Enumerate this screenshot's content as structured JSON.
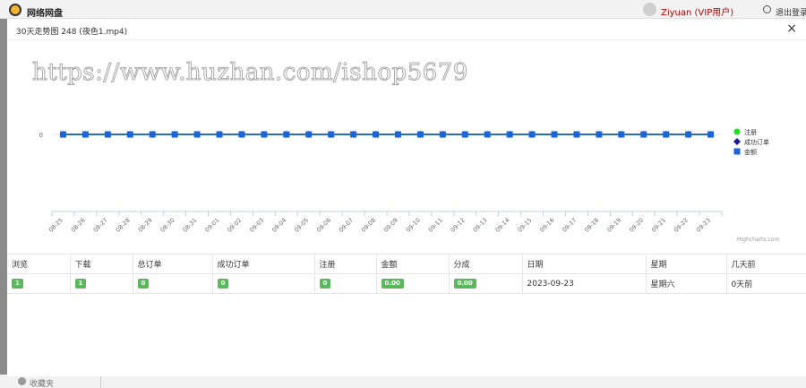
{
  "header": {
    "brand": "网络网盘",
    "user": "Ziyuan (VIP用户)",
    "logout": "退出登录"
  },
  "footer": {
    "favorites": "收藏夹"
  },
  "modal": {
    "title": "30天走势图 248 (夜色1.mp4)",
    "close": "×",
    "watermark": "https://www.huzhan.com/ishop5679"
  },
  "chart_data": {
    "type": "line",
    "x": [
      "08-25",
      "08-26",
      "08-27",
      "08-28",
      "08-29",
      "08-30",
      "08-31",
      "09-01",
      "09-02",
      "09-03",
      "09-04",
      "09-05",
      "09-06",
      "09-07",
      "09-08",
      "09-09",
      "09-10",
      "09-11",
      "09-12",
      "09-13",
      "09-14",
      "09-15",
      "09-16",
      "09-17",
      "09-18",
      "09-19",
      "09-20",
      "09-21",
      "09-22",
      "09-23"
    ],
    "y_ticks": [
      "0"
    ],
    "series": [
      {
        "name": "注册",
        "color": "#22dd22",
        "marker": "circle",
        "values": [
          0,
          0,
          0,
          0,
          0,
          0,
          0,
          0,
          0,
          0,
          0,
          0,
          0,
          0,
          0,
          0,
          0,
          0,
          0,
          0,
          0,
          0,
          0,
          0,
          0,
          0,
          0,
          0,
          0,
          0
        ]
      },
      {
        "name": "成功订单",
        "color": "#1a1a9a",
        "marker": "diamond",
        "values": [
          0,
          0,
          0,
          0,
          0,
          0,
          0,
          0,
          0,
          0,
          0,
          0,
          0,
          0,
          0,
          0,
          0,
          0,
          0,
          0,
          0,
          0,
          0,
          0,
          0,
          0,
          0,
          0,
          0,
          0
        ]
      },
      {
        "name": "金额",
        "color": "#1a66d8",
        "marker": "square",
        "values": [
          0,
          0,
          0,
          0,
          0,
          0,
          0,
          0,
          0,
          0,
          0,
          0,
          0,
          0,
          0,
          0,
          0,
          0,
          0,
          0,
          0,
          0,
          0,
          0,
          0,
          0,
          0,
          0,
          0,
          0
        ]
      }
    ],
    "legend_position": "right",
    "credit": "Highcharts.com"
  },
  "table": {
    "headers": [
      "浏览",
      "下载",
      "总订单",
      "成功订单",
      "注册",
      "金额",
      "分成",
      "日期",
      "星期",
      "几天前"
    ],
    "row": [
      "1",
      "1",
      "0",
      "0",
      "0",
      "0.00",
      "0.00",
      "2023-09-23",
      "星期六",
      "0天前"
    ]
  },
  "colors": {
    "badge": "#5cb85c",
    "user": "#c00000"
  }
}
